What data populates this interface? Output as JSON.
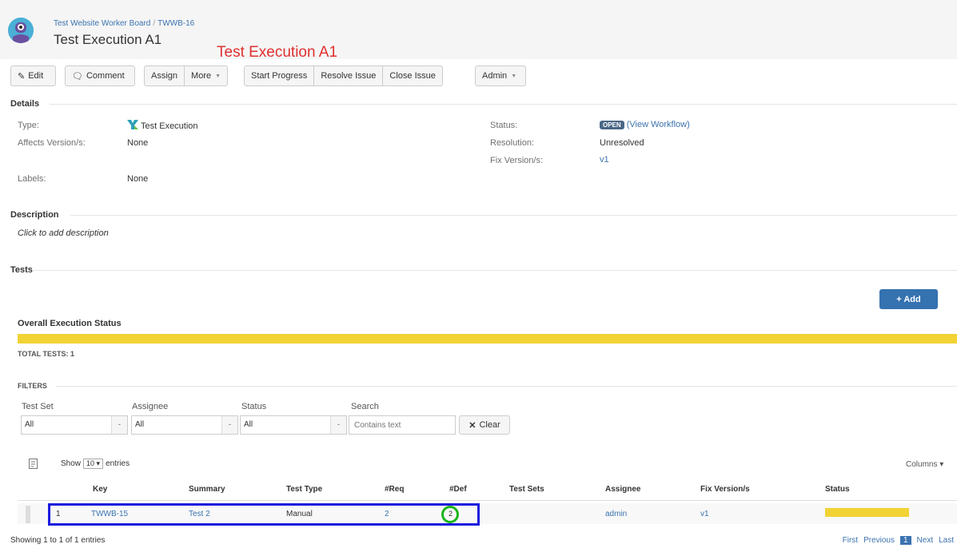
{
  "header": {
    "breadcrumb_project": "Test Website Worker Board",
    "breadcrumb_sep": "/",
    "breadcrumb_issue": "TWWB-16",
    "title": "Test Execution A1",
    "annotation": "Test Execution A1"
  },
  "toolbar": {
    "edit": "Edit",
    "comment": "Comment",
    "assign": "Assign",
    "more": "More",
    "start_progress": "Start Progress",
    "resolve_issue": "Resolve Issue",
    "close_issue": "Close Issue",
    "admin": "Admin"
  },
  "details": {
    "heading": "Details",
    "type_label": "Type:",
    "type_value": "Test Execution",
    "affects_label": "Affects Version/s:",
    "affects_value": "None",
    "labels_label": "Labels:",
    "labels_value": "None",
    "status_label": "Status:",
    "status_value": "OPEN",
    "view_workflow": "(View Workflow)",
    "resolution_label": "Resolution:",
    "resolution_value": "Unresolved",
    "fix_label": "Fix Version/s:",
    "fix_value": "v1"
  },
  "description": {
    "heading": "Description",
    "placeholder": "Click to add description"
  },
  "tests": {
    "heading": "Tests",
    "add_button": "+ Add",
    "overall_heading": "Overall Execution Status",
    "progress_fraction": 1.0,
    "progress_color": "#f1d335",
    "total": "TOTAL TESTS: 1"
  },
  "filters": {
    "heading": "FILTERS",
    "test_set_label": "Test Set",
    "test_set_value": "All",
    "assignee_label": "Assignee",
    "assignee_value": "All",
    "status_label": "Status",
    "status_value": "All",
    "search_label": "Search",
    "search_placeholder": "Contains text",
    "clear": "Clear"
  },
  "table": {
    "show": "Show",
    "entries_value": "10",
    "entries": "entries",
    "columns": "Columns",
    "headers": [
      "Key",
      "Summary",
      "Test Type",
      "#Req",
      "#Def",
      "Test Sets",
      "Assignee",
      "Fix Version/s",
      "Status"
    ],
    "rows": [
      {
        "num": "1",
        "key": "TWWB-15",
        "summary": "Test 2",
        "type": "Manual",
        "req": "2",
        "def": "2",
        "sets": "",
        "assignee": "admin",
        "fix": "v1",
        "status_color": "#f1d335"
      }
    ],
    "footer": "Showing 1 to 1 of 1 entries",
    "pager": {
      "first": "First",
      "previous": "Previous",
      "current": "1",
      "next": "Next",
      "last": "Last"
    }
  },
  "colors": {
    "annotation_red": "#e03030",
    "highlight_blue": "#1a1adf",
    "circle_green": "#1bb51b",
    "add_button_blue": "#3572b0"
  }
}
